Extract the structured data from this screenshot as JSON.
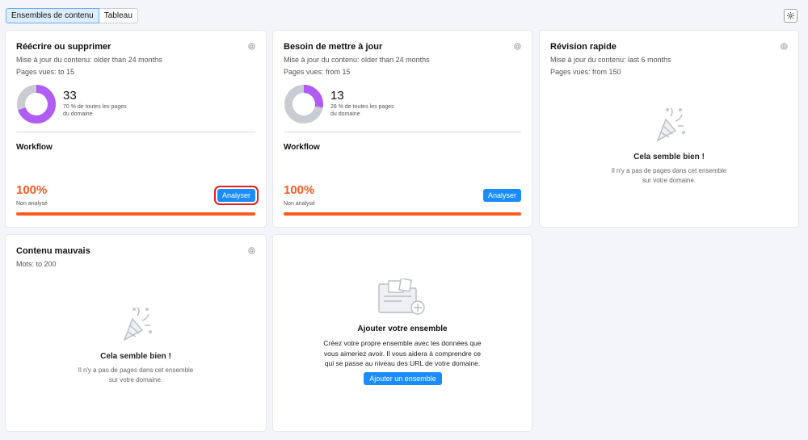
{
  "tabs": [
    {
      "label": "Ensembles de contenu"
    },
    {
      "label": "Tableau"
    }
  ],
  "cards": {
    "rewrite": {
      "title": "Réécrire ou supprimer",
      "line1": "Mise à jour du contenu: older than 24 months",
      "line2": "Pages vues: to 15",
      "count": "33",
      "share_line1": "70 % de toutes les pages",
      "share_line2": "du domaine",
      "share_fraction": 0.7,
      "workflow_label": "Workflow",
      "percent": "100%",
      "status": "Non analysé",
      "analyze_label": "Analyser"
    },
    "update": {
      "title": "Besoin de mettre à jour",
      "line1": "Mise à jour du contenu: older than 24 months",
      "line2": "Pages vues: from 15",
      "count": "13",
      "share_line1": "28 % de toutes les pages",
      "share_line2": "du domaine",
      "share_fraction": 0.28,
      "workflow_label": "Workflow",
      "percent": "100%",
      "status": "Non analysé",
      "analyze_label": "Analyser"
    },
    "quick": {
      "title": "Révision rapide",
      "line1": "Mise à jour du contenu: last 6 months",
      "line2": "Pages vues: from 150",
      "empty_title": "Cela semble bien !",
      "empty_line1": "Il n'y a pas de pages dans cet ensemble",
      "empty_line2": "sur votre domaine."
    },
    "bad": {
      "title": "Contenu mauvais",
      "line1": "Mots: to 200",
      "empty_title": "Cela semble bien !",
      "empty_line1": "Il n'y a pas de pages dans cet ensemble",
      "empty_line2": "sur votre domaine."
    },
    "add": {
      "title": "Ajouter votre ensemble",
      "line1": "Créez votre propre ensemble avec les données que",
      "line2": "vous aimeriez avoir. Il vous aidera à comprendre ce",
      "line3": "qui se passe au niveau des URL de votre domaine.",
      "button_label": "Ajouter un ensemble"
    }
  },
  "colors": {
    "accent": "#1a8cff",
    "orange": "#ff5a1f",
    "donut_fill": "#b05cf5",
    "donut_rest": "#c9ccd3"
  },
  "icons": {
    "settings": "gear-icon",
    "party": "party-popper-icon",
    "folder": "folder-add-icon"
  }
}
